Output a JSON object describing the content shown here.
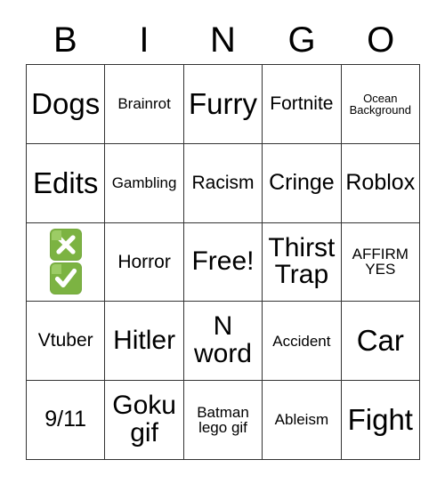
{
  "card": {
    "header_letters": [
      "B",
      "I",
      "N",
      "G",
      "O"
    ],
    "accent_color": "#7cb342",
    "accent_highlight_color": "#9ccc65",
    "border_color": "#333333",
    "rows": [
      [
        {
          "label": "Dogs",
          "size": "xxl",
          "marked": false
        },
        {
          "label": "Brainrot",
          "size": "s",
          "marked": false
        },
        {
          "label": "Furry",
          "size": "xxl",
          "marked": false
        },
        {
          "label": "Fortnite",
          "size": "m",
          "marked": false
        },
        {
          "label": "Ocean Background",
          "size": "xs",
          "marked": false
        }
      ],
      [
        {
          "label": "Edits",
          "size": "xxl",
          "marked": false
        },
        {
          "label": "Gambling",
          "size": "s",
          "marked": false
        },
        {
          "label": "Racism",
          "size": "m",
          "marked": false
        },
        {
          "label": "Cringe",
          "size": "l",
          "marked": false
        },
        {
          "label": "Roblox",
          "size": "l",
          "marked": false
        }
      ],
      [
        {
          "label": "",
          "size": "m",
          "marked": true,
          "marks": [
            "cross-icon",
            "check-icon"
          ]
        },
        {
          "label": "Horror",
          "size": "m",
          "marked": false
        },
        {
          "label": "Free!",
          "size": "xl",
          "marked": false
        },
        {
          "label": "Thirst Trap",
          "size": "xl",
          "marked": false
        },
        {
          "label": "AFFIRM YES",
          "size": "s",
          "marked": false
        }
      ],
      [
        {
          "label": "Vtuber",
          "size": "m",
          "marked": false
        },
        {
          "label": "Hitler",
          "size": "xl",
          "marked": false
        },
        {
          "label": "N word",
          "size": "xl",
          "marked": false
        },
        {
          "label": "Accident",
          "size": "s",
          "marked": false
        },
        {
          "label": "Car",
          "size": "xxl",
          "marked": false
        }
      ],
      [
        {
          "label": "9/11",
          "size": "l",
          "marked": false
        },
        {
          "label": "Goku gif",
          "size": "xl",
          "marked": false
        },
        {
          "label": "Batman lego gif",
          "size": "s",
          "marked": false
        },
        {
          "label": "Ableism",
          "size": "s",
          "marked": false
        },
        {
          "label": "Fight",
          "size": "xxl",
          "marked": false
        }
      ]
    ]
  }
}
